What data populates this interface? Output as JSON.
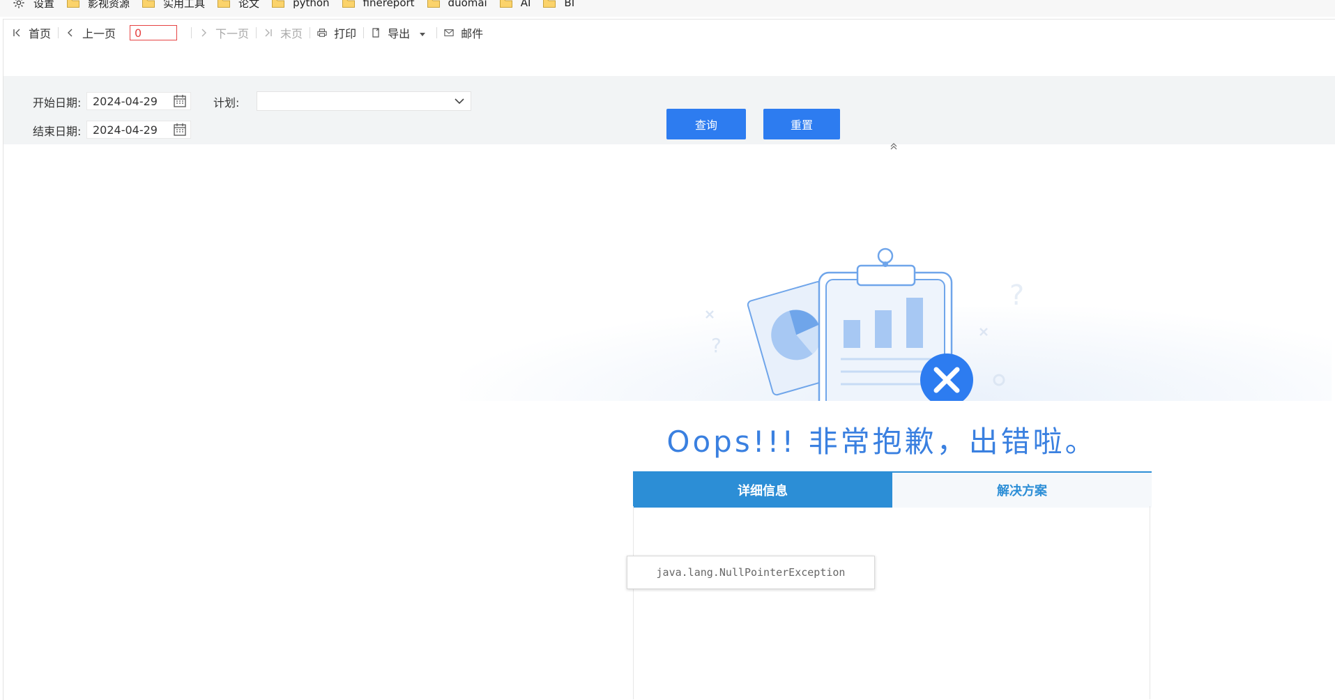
{
  "bookmarks": [
    {
      "label": "设置",
      "icon": "gear-icon"
    },
    {
      "label": "影视资源",
      "icon": "folder-icon"
    },
    {
      "label": "实用工具",
      "icon": "folder-icon"
    },
    {
      "label": "论文",
      "icon": "folder-icon"
    },
    {
      "label": "python",
      "icon": "folder-icon"
    },
    {
      "label": "finereport",
      "icon": "folder-icon"
    },
    {
      "label": "duomai",
      "icon": "folder-icon"
    },
    {
      "label": "AI",
      "icon": "folder-icon"
    },
    {
      "label": "BI",
      "icon": "folder-icon"
    }
  ],
  "toolbar": {
    "first_page": "首页",
    "prev_page": "上一页",
    "page_number": "0",
    "next_page": "下一页",
    "last_page": "末页",
    "print": "打印",
    "export": "导出",
    "email": "邮件"
  },
  "params": {
    "start_label": "开始日期:",
    "start_value": "2024-04-29",
    "end_label": "结束日期:",
    "end_value": "2024-04-29",
    "plan_label": "计划:",
    "plan_value": "",
    "query_button": "查询",
    "reset_button": "重置"
  },
  "error": {
    "title": "Oops!!! 非常抱歉，出错啦。",
    "tab_details": "详细信息",
    "tab_solution": "解决方案",
    "exception": "java.lang.NullPointerException"
  },
  "colors": {
    "primary_button": "#2d7cf0",
    "tab_active": "#2c8ed6",
    "oops_text": "#3a80e0",
    "page_input_border": "#e64343"
  }
}
